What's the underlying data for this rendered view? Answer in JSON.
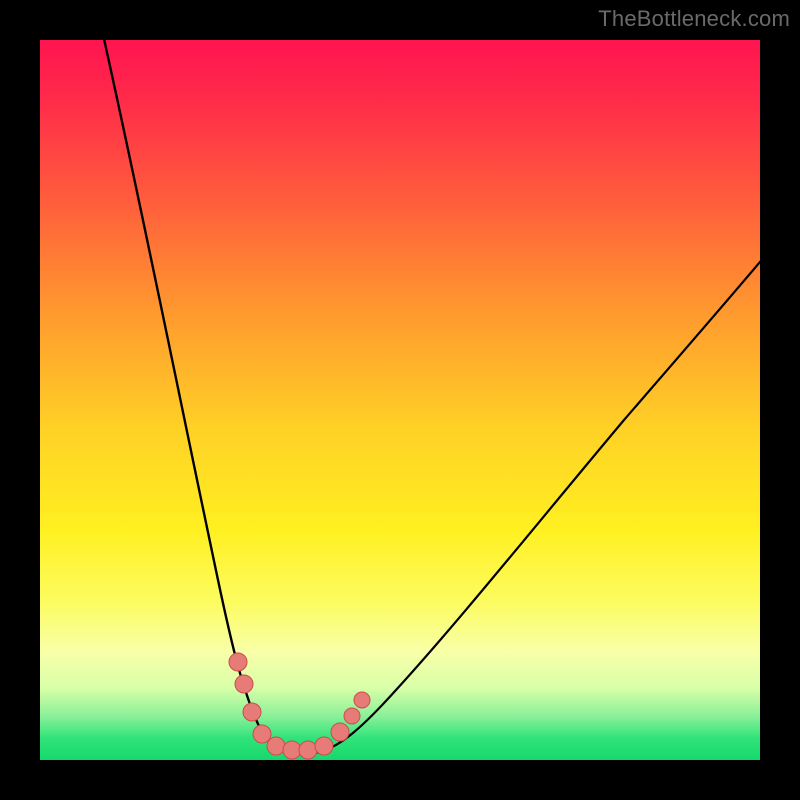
{
  "watermark": {
    "text": "TheBottleneck.com"
  },
  "colors": {
    "page_bg": "#000000",
    "curve_stroke": "#000000",
    "marker_fill": "#e77b78",
    "marker_stroke": "#c94e49",
    "gradient_stops": [
      "#ff1450",
      "#ff2a4a",
      "#ff5c3c",
      "#ff9a2e",
      "#ffd126",
      "#fff021",
      "#fcfc60",
      "#f8ffa8",
      "#d8ffa8",
      "#88f098",
      "#2fe37a",
      "#17d86c"
    ]
  },
  "chart_data": {
    "type": "line",
    "title": "",
    "xlabel": "",
    "ylabel": "",
    "xlim": [
      0,
      100
    ],
    "ylim": [
      0,
      100
    ],
    "grid": false,
    "legend": false,
    "series": [
      {
        "name": "bottleneck-curve",
        "x": [
          10,
          14,
          18,
          22,
          25,
          27,
          29,
          30,
          31,
          33,
          35,
          37,
          40,
          45,
          52,
          60,
          70,
          82,
          92,
          100
        ],
        "y": [
          100,
          80,
          60,
          40,
          25,
          15,
          8,
          4,
          2,
          1,
          1,
          2,
          3,
          6,
          12,
          20,
          30,
          42,
          52,
          60
        ]
      }
    ],
    "markers": {
      "name": "highlighted-points",
      "x": [
        27,
        28.5,
        30,
        32,
        33.5,
        35,
        36,
        38.5,
        40,
        41
      ],
      "y": [
        14,
        10,
        6,
        3,
        2,
        2,
        2.5,
        5,
        8,
        12
      ]
    }
  }
}
